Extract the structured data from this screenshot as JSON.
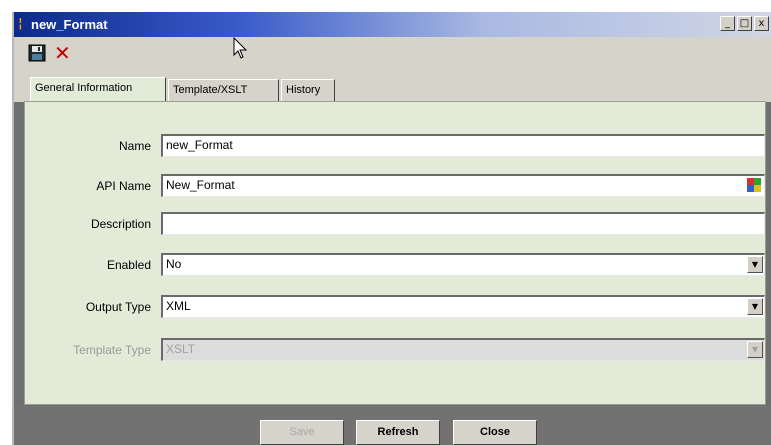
{
  "window": {
    "title": "new_Format",
    "controls": [
      "_",
      "□",
      "x"
    ]
  },
  "tabs": [
    {
      "label": "General Information",
      "active": true
    },
    {
      "label": "Template/XSLT",
      "active": false
    },
    {
      "label": "History",
      "active": false
    }
  ],
  "form": {
    "name": {
      "label": "Name",
      "value": "new_Format"
    },
    "api_name": {
      "label": "API Name",
      "value": "New_Format"
    },
    "description": {
      "label": "Description",
      "value": ""
    },
    "enabled": {
      "label": "Enabled",
      "value": "No"
    },
    "output_type": {
      "label": "Output Type",
      "value": "XML"
    },
    "template_type": {
      "label": "Template Type",
      "value": "XSLT",
      "disabled": true
    }
  },
  "buttons": {
    "save": "Save",
    "refresh": "Refresh",
    "close": "Close"
  },
  "colors": {
    "titlebar_start": "#0c2a8c",
    "panel_bg": "#e3ebd8",
    "delete_red": "#c80000"
  }
}
